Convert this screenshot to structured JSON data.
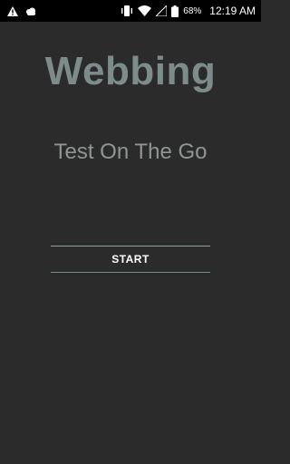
{
  "status_bar": {
    "icons_left": [
      "warning-icon",
      "cloud-icon"
    ],
    "icons_right": [
      "vibrate-icon",
      "wifi-icon",
      "signal-icon",
      "battery-icon"
    ],
    "battery": "68%",
    "time": "12:19 AM"
  },
  "main": {
    "title": "Webbing",
    "subtitle": "Test On The Go",
    "start_label": "START"
  },
  "colors": {
    "background": "#2b2b2b",
    "title": "#7c8c8a",
    "subtitle": "#8f9593",
    "button_line": "#8fa39f"
  }
}
